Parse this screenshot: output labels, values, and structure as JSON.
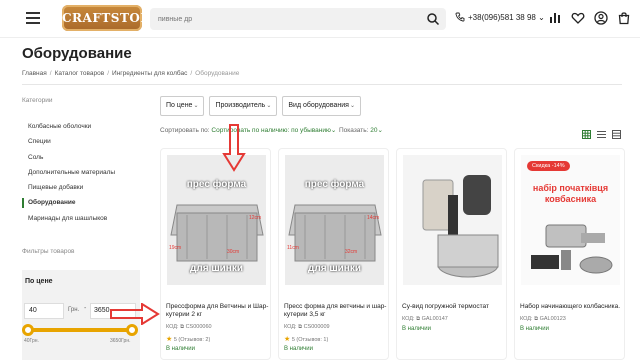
{
  "header": {
    "logo_text": "CRAFTSTORE",
    "search_placeholder": "пивные др",
    "phone": "+38(096)581 38 98",
    "phone_chevron": "⌄"
  },
  "page": {
    "title": "Оборудование",
    "breadcrumb": [
      "Главная",
      "Каталог товаров",
      "Ингредиенты для колбас",
      "Оборудование"
    ]
  },
  "sidebar": {
    "categories_heading": "Категории",
    "categories": [
      {
        "label": "Колбасные оболочки",
        "active": false
      },
      {
        "label": "Специи",
        "active": false
      },
      {
        "label": "Соль",
        "active": false
      },
      {
        "label": "Дополнительные материалы",
        "active": false
      },
      {
        "label": "Пищевые добавки",
        "active": false
      },
      {
        "label": "Оборудование",
        "active": true
      },
      {
        "label": "Маринады для шашлыков",
        "active": false
      }
    ],
    "filters_heading": "Фильтры товаров",
    "price": {
      "title": "По цене",
      "min": "40",
      "max": "3650",
      "currency": "Грн.",
      "dash": "-",
      "min_label": "40Грн.",
      "max_label": "3650Грн."
    }
  },
  "filters": {
    "buttons": [
      "По цене",
      "Производитель",
      "Вид оборудования"
    ]
  },
  "sort": {
    "label": "Сортировать по:",
    "value": "Сортировать по наличию: по убыванию",
    "show_label": "Показать:",
    "show_value": "20"
  },
  "products": [
    {
      "name": "Прессформа для Ветчины и Шар-кутерии 2 кг",
      "code_label": "КОД:",
      "code": "CS000060",
      "rating": "5 (Отзывов: 2)",
      "stock": "В наличии",
      "image_text_top": "прес форма",
      "image_text_bottom": "для шинки",
      "dim1": "19cm",
      "dim2": "12cm",
      "dim3": "30cm"
    },
    {
      "name": "Пресс форма для ветчины и шар-кутерии 3,5 кг",
      "code_label": "КОД:",
      "code": "CS000009",
      "rating": "5 (Отзывов: 1)",
      "stock": "В наличии",
      "image_text_top": "прес форма",
      "image_text_bottom": "для шинки",
      "dim1": "11cm",
      "dim2": "14cm",
      "dim3": "32cm"
    },
    {
      "name": "Су-вид погружной термостат",
      "code_label": "КОД:",
      "code": "GAL00147",
      "stock": "В наличии"
    },
    {
      "name": "Набор начинающего колбасника.",
      "code_label": "КОД:",
      "code": "GAL00123",
      "stock": "В наличии",
      "badge": "Скидка -14%",
      "image_text": "набір початківця ковбасника"
    }
  ],
  "colors": {
    "accent_green": "#2e7d32",
    "slider": "#e8a400",
    "annotation_red": "#e53935"
  }
}
